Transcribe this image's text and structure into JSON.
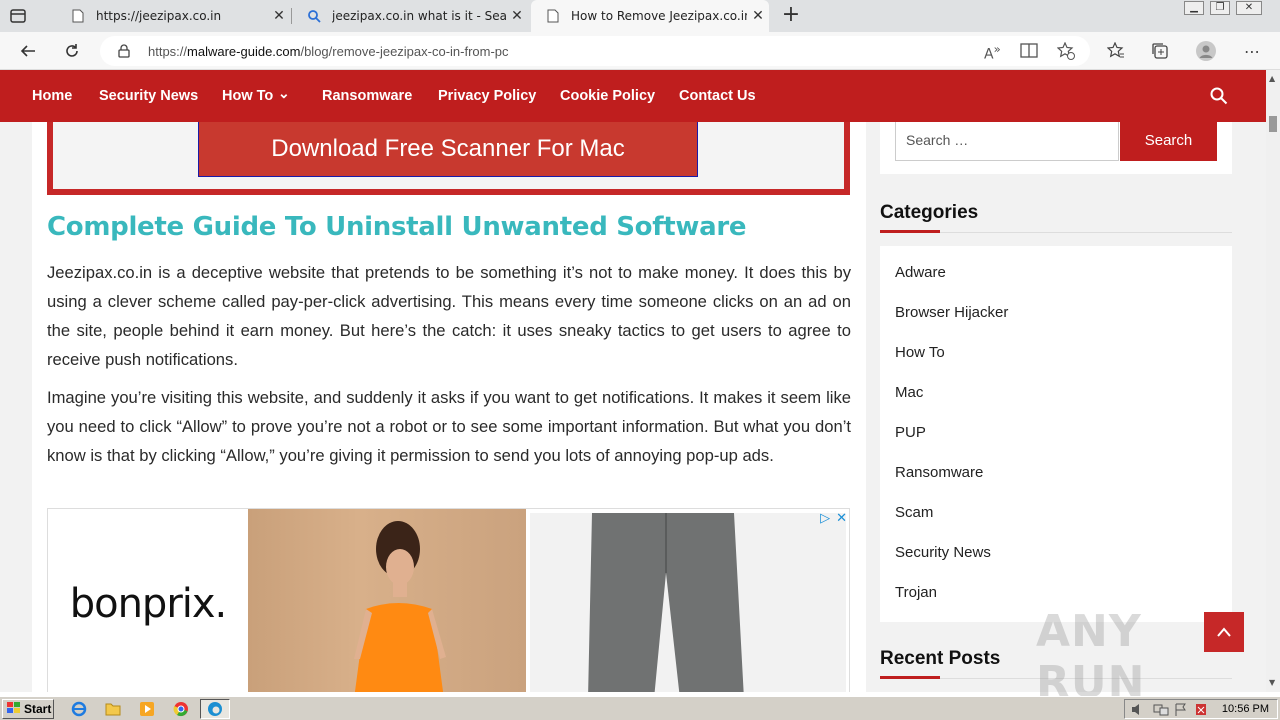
{
  "browser": {
    "tabs": [
      {
        "title": "https://jeezipax.co.in",
        "close": "✕"
      },
      {
        "title": "jeezipax.co.in what is it - Search",
        "close": "✕"
      },
      {
        "title": "How to Remove Jeezipax.co.in f",
        "close": "✕"
      }
    ],
    "new_tab": "+",
    "url_prefix": "https://",
    "url_domain": "malware-guide.com",
    "url_path": "/blog/remove-jeezipax-co-in-from-pc"
  },
  "site_nav": {
    "items": [
      "Home",
      "Security News",
      "How To",
      "Ransomware",
      "Privacy Policy",
      "Cookie Policy",
      "Contact Us"
    ],
    "dropdown_marker": "⌄"
  },
  "main": {
    "scanner_button": "Download Free Scanner For Mac",
    "guide_title": "Complete Guide To Uninstall Unwanted Software",
    "paragraph1": "Jeezipax.co.in is a deceptive website that pretends to be something it’s not to make money. It does this by using a clever scheme called pay-per-click advertising. This means every time someone clicks on an ad on the site, people behind it earn money. But here’s the catch: it uses sneaky tactics to get users to agree to receive push notifications.",
    "paragraph2": "Imagine you’re visiting this website, and suddenly it asks if you want to get notifications. It makes it seem like you need to click “Allow” to prove you’re not a robot or to see some important information. But what you don’t know is that by clicking “Allow,” you’re giving it permission to send you lots of annoying pop-up ads.",
    "ad_brand": "bonprix."
  },
  "sidebar": {
    "search_placeholder": "Search …",
    "search_button": "Search",
    "categories_heading": "Categories",
    "categories": [
      "Adware",
      "Browser Hijacker",
      "How To",
      "Mac",
      "PUP",
      "Ransomware",
      "Scam",
      "Security News",
      "Trojan"
    ],
    "recent_heading": "Recent Posts"
  },
  "watermark": "ANY RUN",
  "taskbar": {
    "start": "Start",
    "clock": "10:56 PM"
  }
}
